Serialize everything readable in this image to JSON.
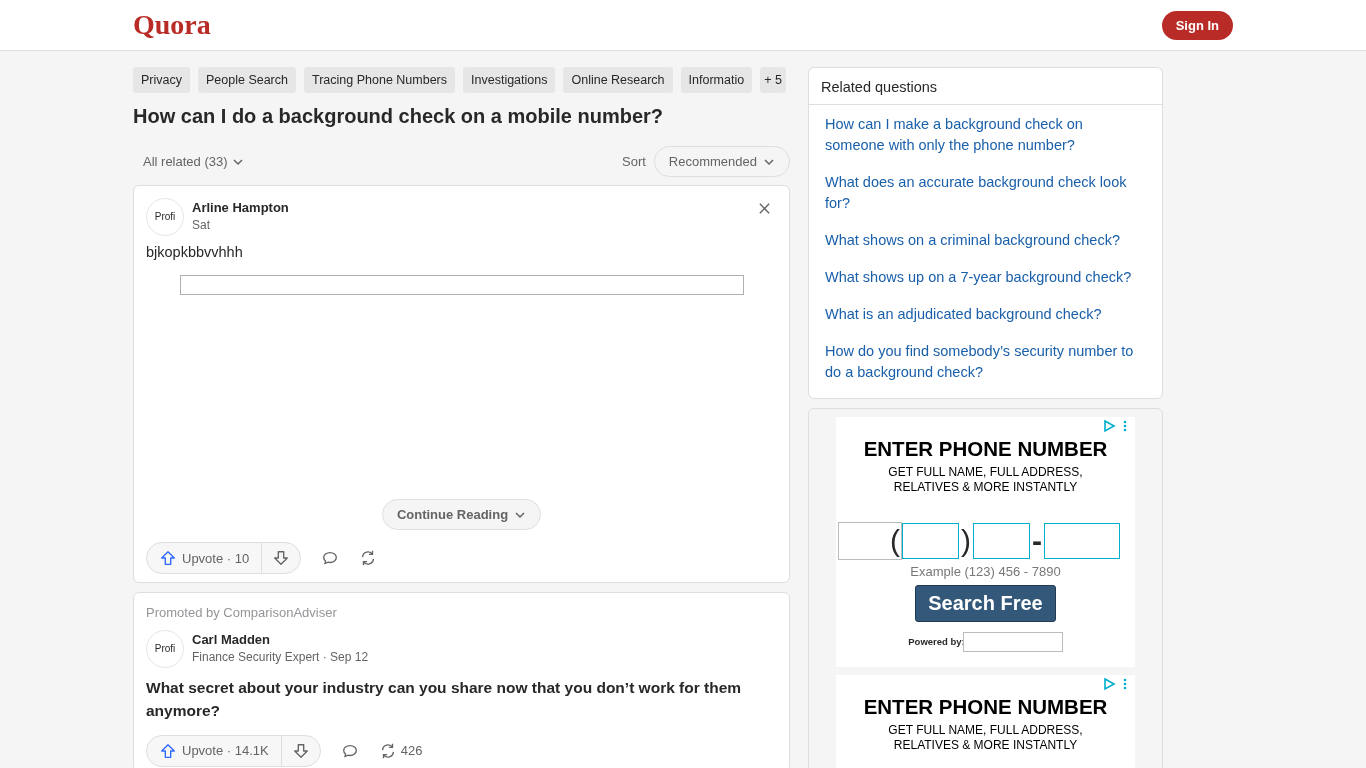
{
  "header": {
    "logo": "Quora",
    "sign_in": "Sign In"
  },
  "topics": [
    {
      "label": "Privacy"
    },
    {
      "label": "People Search"
    },
    {
      "label": "Tracing Phone Numbers"
    },
    {
      "label": "Investigations"
    },
    {
      "label": "Online Research"
    },
    {
      "label": "Informatio"
    }
  ],
  "topics_more": "+ 5",
  "question": "How can I do a background check on a mobile number?",
  "filter": {
    "label": "All related (33)",
    "sort_label": "Sort",
    "sort_value": "Recommended"
  },
  "answers": [
    {
      "kind": "answer",
      "author": "Arline Hampton",
      "avatar_alt": "Profi",
      "meta": "Sat",
      "text": "bjkopkbbvvhhh",
      "has_image": true,
      "continue": "Continue Reading",
      "upvote": "Upvote · 10"
    },
    {
      "kind": "promoted",
      "promoted": "Promoted by ComparisonAdviser",
      "author": "Carl Madden",
      "avatar_alt": "Profi",
      "meta": "Finance Security Expert · Sep 12",
      "title": "What secret about your industry can you share now that you don’t work for them anymore?",
      "has_image": false,
      "upvote": "Upvote · 14.1K",
      "share_count": "426"
    }
  ],
  "related": {
    "title": "Related questions",
    "items": [
      "How can I make a background check on someone with only the phone number?",
      "What does an accurate background check look for?",
      "What shows on a criminal background check?",
      "What shows up on a 7-year background check?",
      "What is an adjudicated background check?",
      "How do you find somebody’s security number to do a background check?"
    ]
  },
  "ads": [
    {
      "kind": "full",
      "headline": "ENTER PHONE NUMBER",
      "subline": "GET FULL NAME, FULL ADDRESS, RELATIVES & MORE INSTANTLY",
      "open_paren": "(",
      "close_paren": ")",
      "dash": "-",
      "example": "Example (123) 456 - 7890",
      "button": "Search Free",
      "powered": "Powered by:"
    },
    {
      "kind": "partial",
      "headline": "ENTER PHONE NUMBER",
      "subline": "GET FULL NAME, FULL ADDRESS, RELATIVES & MORE INSTANTLY"
    }
  ]
}
